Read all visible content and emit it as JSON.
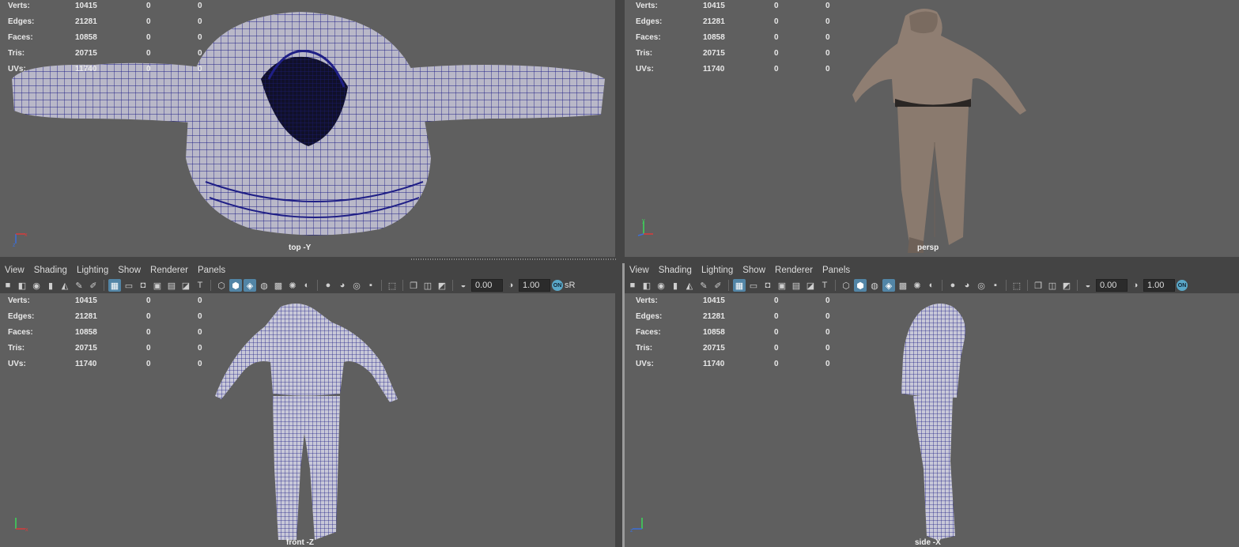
{
  "menu": [
    "View",
    "Shading",
    "Lighting",
    "Show",
    "Renderer",
    "Panels"
  ],
  "toolbar": {
    "exposure": "0.00",
    "gamma": "1.00",
    "colorspace": "sR",
    "on_badge": "ON"
  },
  "hud_stats": [
    {
      "label": "Verts:",
      "values": [
        "10415",
        "0",
        "0"
      ]
    },
    {
      "label": "Edges:",
      "values": [
        "21281",
        "0",
        "0"
      ]
    },
    {
      "label": "Faces:",
      "values": [
        "10858",
        "0",
        "0"
      ]
    },
    {
      "label": "Tris:",
      "values": [
        "20715",
        "0",
        "0"
      ]
    },
    {
      "label": "UVs:",
      "values": [
        "11740",
        "0",
        "0"
      ]
    }
  ],
  "viewports": {
    "top": {
      "label": "top -Y"
    },
    "persp": {
      "label": "persp"
    },
    "front": {
      "label": "front -Z"
    },
    "side": {
      "label": "side -X"
    }
  },
  "colors": {
    "wire": "#1f1f86",
    "mesh_fill": "#b9b8c8",
    "cloth": "#8f7e72",
    "bg": "#5f5f5f",
    "panel": "#444444",
    "accent": "#5285a6"
  },
  "icons": [
    "camera-icon",
    "grid-icon",
    "wireframe-icon",
    "smooth-shade-icon",
    "texture-icon",
    "light-icon",
    "xray-icon",
    "isolate-icon"
  ]
}
